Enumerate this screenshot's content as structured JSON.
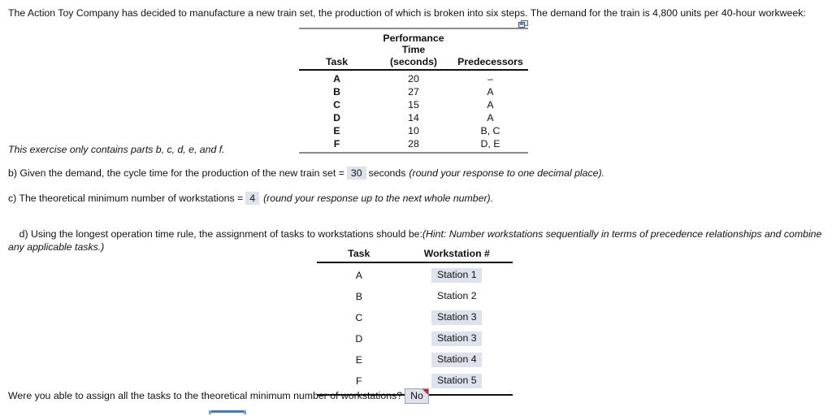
{
  "intro": {
    "text": "The Action Toy Company has decided to manufacture a new train set, the production of which is broken into six steps. The demand for the train is 4,800 units per 40-hour workweek:"
  },
  "icons": {
    "copy": "copy-popout-icon"
  },
  "performance_table": {
    "headers": {
      "task": "Task",
      "time_line1": "Performance Time",
      "time_line2": "(seconds)",
      "predecessors": "Predecessors"
    },
    "rows": [
      {
        "task": "A",
        "time": "20",
        "predecessors": "–"
      },
      {
        "task": "B",
        "time": "27",
        "predecessors": "A"
      },
      {
        "task": "C",
        "time": "15",
        "predecessors": "A"
      },
      {
        "task": "D",
        "time": "14",
        "predecessors": "A"
      },
      {
        "task": "E",
        "time": "10",
        "predecessors": "B, C"
      },
      {
        "task": "F",
        "time": "28",
        "predecessors": "D, E"
      }
    ]
  },
  "exercise_note": "This exercise only contains parts b, c, d, e, and f.",
  "question_b": {
    "prefix": "b) Given the demand, the cycle time for the production of the new train set =",
    "answer": "30",
    "middle": "seconds",
    "hint": "(round your response to one decimal place)."
  },
  "question_c": {
    "prefix": "c) The theoretical minimum number of workstations =",
    "answer": "4",
    "hint": "(round your response up to the next whole number)."
  },
  "question_d": {
    "prefix": "d) Using the longest operation time rule, the assignment of tasks to workstations should be:",
    "hint": "(Hint: Number workstations sequentially in terms of precedence relationships and combine any applicable tasks.)"
  },
  "station_table": {
    "headers": {
      "task": "Task",
      "workstation": "Workstation #"
    },
    "rows": [
      {
        "task": "A",
        "workstation": "Station 1",
        "highlighted": true
      },
      {
        "task": "B",
        "workstation": "Station 2",
        "highlighted": false
      },
      {
        "task": "C",
        "workstation": "Station 3",
        "highlighted": true
      },
      {
        "task": "D",
        "workstation": "Station 3",
        "highlighted": true
      },
      {
        "task": "E",
        "workstation": "Station 4",
        "highlighted": true
      },
      {
        "task": "F",
        "workstation": "Station 5",
        "highlighted": true
      }
    ]
  },
  "question_final": {
    "prefix": "Were you able to assign all the tasks to the theoretical minimum number of workstations?",
    "answer": "No"
  },
  "colors": {
    "answer_fill": "#dde2ec",
    "flag_marker": "#d61f16",
    "rule_dark": "#111111",
    "rule_light": "#8b8b8b",
    "widget_blue": "#3f7ac4"
  }
}
